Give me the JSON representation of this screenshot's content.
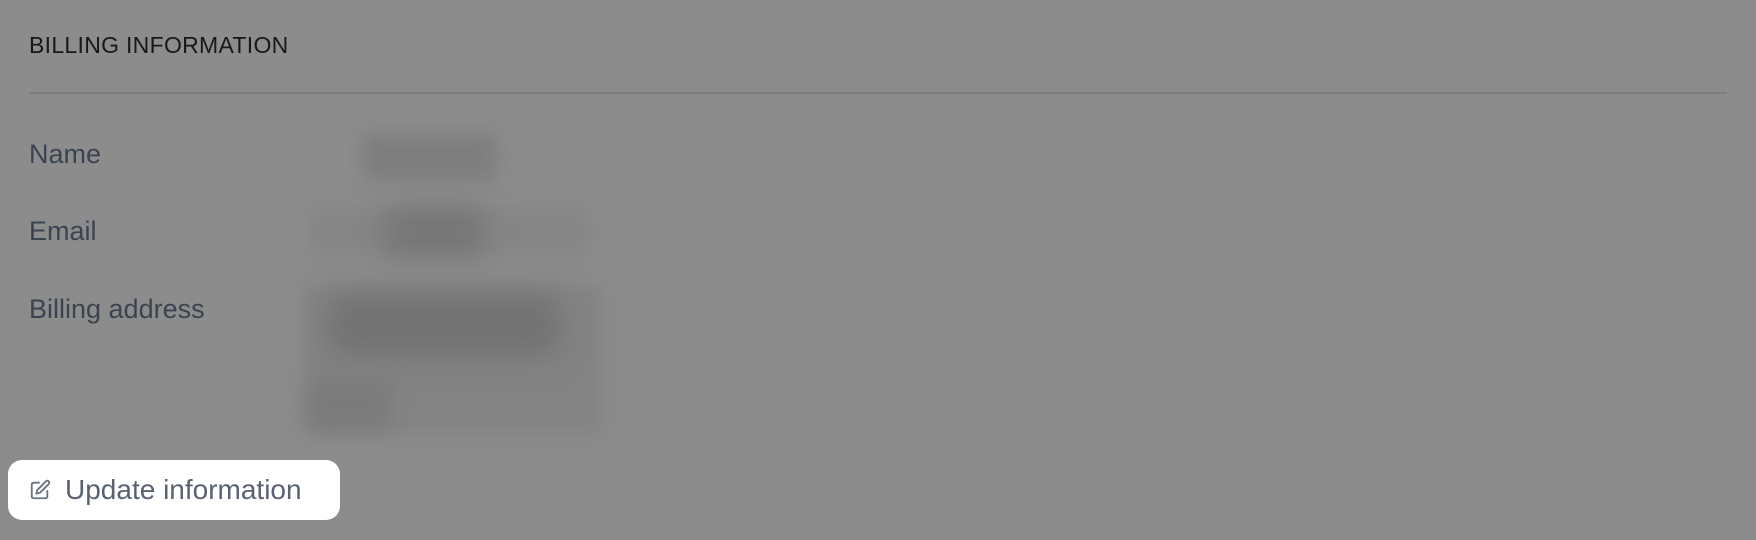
{
  "billing": {
    "title": "BILLING INFORMATION",
    "rows": [
      {
        "label": "Name"
      },
      {
        "label": "Email"
      },
      {
        "label": "Billing address"
      }
    ]
  },
  "actions": {
    "update_label": "Update information",
    "update_icon": "edit-icon"
  }
}
